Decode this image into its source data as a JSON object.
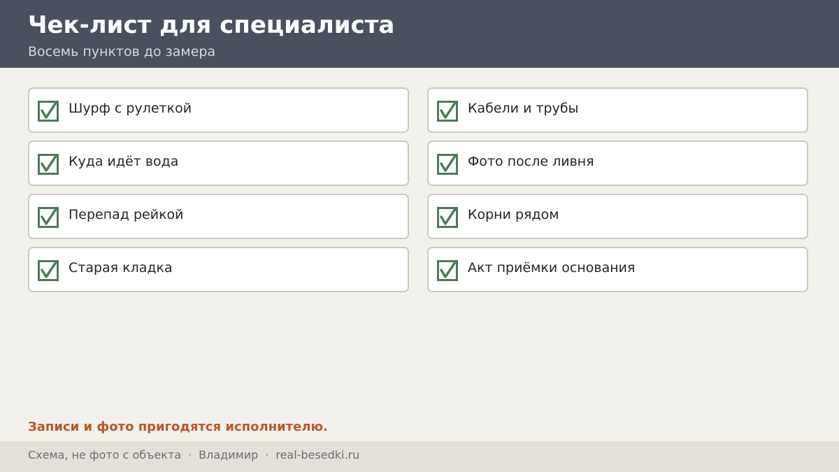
{
  "header": {
    "title": "Чек-лист для специалиста",
    "subtitle": "Восемь пунктов до замера"
  },
  "checklist": {
    "items": [
      {
        "label": "Шурф с рулеткой",
        "checked": true
      },
      {
        "label": "Кабели и трубы",
        "checked": true
      },
      {
        "label": "Куда идёт вода",
        "checked": true
      },
      {
        "label": "Фото после ливня",
        "checked": true
      },
      {
        "label": "Перепад рейкой",
        "checked": true
      },
      {
        "label": "Корни рядом",
        "checked": true
      },
      {
        "label": "Старая кладка",
        "checked": true
      },
      {
        "label": "Акт приёмки основания",
        "checked": true
      }
    ],
    "check_icon": "checked-checkbox-icon"
  },
  "note": "Записи и фото пригодятся исполнителю.",
  "footer": {
    "caption": "Схема, не фото с объекта",
    "separator": "·",
    "author": "Владимир",
    "site": "real-besedki.ru"
  },
  "colors": {
    "header_bg": "#48515d",
    "page_bg": "#f3f1ec",
    "check": "#4f7a58",
    "accent": "#b9582c",
    "footer_bg": "#e3e0da"
  }
}
